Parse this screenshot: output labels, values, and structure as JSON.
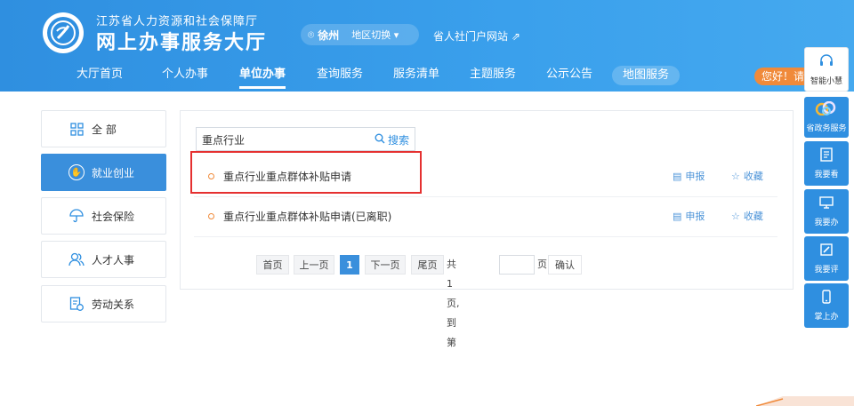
{
  "header": {
    "org_name": "江苏省人力资源和社会保障厅",
    "site_title": "网上办事服务大厅",
    "city": "徐州",
    "region_switch": "地区切换 ▾",
    "portal_link": "省人社门户网站 ⇗",
    "greeting": "您好！请登录"
  },
  "nav": {
    "items": [
      {
        "label": "大厅首页"
      },
      {
        "label": "个人办事"
      },
      {
        "label": "单位办事"
      },
      {
        "label": "查询服务"
      },
      {
        "label": "服务清单"
      },
      {
        "label": "主题服务"
      },
      {
        "label": "公示公告"
      },
      {
        "label": "地图服务"
      }
    ],
    "active_index": 2
  },
  "side_menu": {
    "items": [
      {
        "label": "全 部",
        "icon": "grid-icon"
      },
      {
        "label": "就业创业",
        "icon": "employment-icon"
      },
      {
        "label": "社会保险",
        "icon": "umbrella-icon"
      },
      {
        "label": "人才人事",
        "icon": "people-icon"
      },
      {
        "label": "劳动关系",
        "icon": "document-icon"
      }
    ],
    "active_index": 1
  },
  "search": {
    "value": "重点行业",
    "button_label": "搜索"
  },
  "results": [
    {
      "title": "重点行业重点群体补贴申请",
      "apply_label": "申报",
      "fav_label": "收藏"
    },
    {
      "title": "重点行业重点群体补贴申请(已离职)",
      "apply_label": "申报",
      "fav_label": "收藏"
    }
  ],
  "pagination": {
    "first": "首页",
    "prev": "上一页",
    "current": "1",
    "next": "下一页",
    "last": "尾页",
    "summary": "共1页, 到第",
    "page_suffix": "页",
    "confirm": "确认"
  },
  "float_bar": {
    "items": [
      {
        "label": "智能小慧",
        "icon": "headset-icon"
      },
      {
        "label": "省政务服务",
        "icon": "gov-logo-icon"
      },
      {
        "label": "我要看",
        "icon": "book-icon"
      },
      {
        "label": "我要办",
        "icon": "monitor-icon"
      },
      {
        "label": "我要评",
        "icon": "edit-icon"
      },
      {
        "label": "掌上办",
        "icon": "phone-icon"
      }
    ]
  },
  "colors": {
    "brand_blue": "#2f8fe0",
    "active_blue": "#3a8fdc",
    "accent_orange": "#f08a3a",
    "highlight_red": "#e53030"
  }
}
